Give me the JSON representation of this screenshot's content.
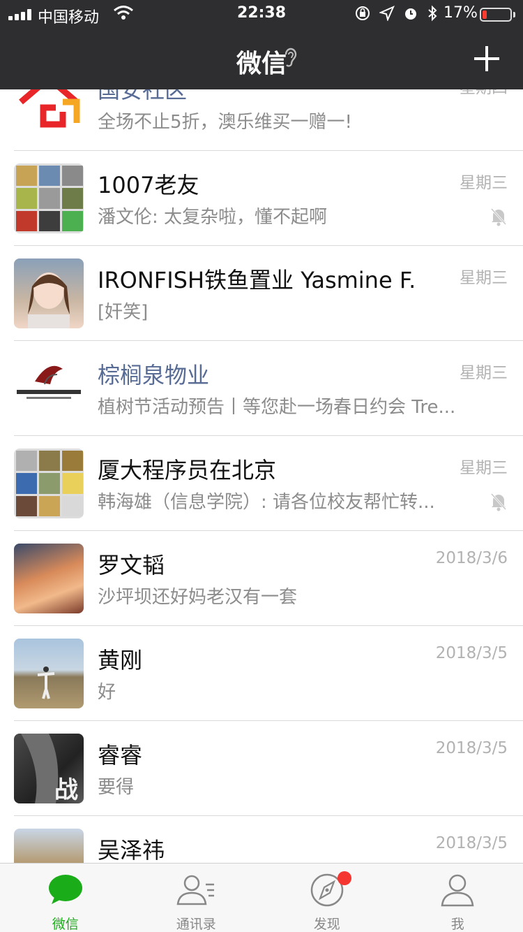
{
  "status_bar": {
    "carrier": "中国移动",
    "time": "22:38",
    "battery_percent": "17%",
    "battery_level": 0.17,
    "battery_color": "#ff3b30"
  },
  "nav": {
    "title": "微信",
    "title_icon": "ear-icon",
    "add_icon": "plus-icon"
  },
  "chats": [
    {
      "name": "国安社区",
      "preview": "全场不止5折，澳乐维买一赠一!",
      "time": "星期四",
      "official": true,
      "muted": false
    },
    {
      "name": "1007老友",
      "preview": "潘文伦: 太复杂啦，懂不起啊",
      "time": "星期三",
      "official": false,
      "muted": true
    },
    {
      "name": "IRONFISH铁鱼置业 Yasmine F.",
      "preview": "[奸笑]",
      "time": "星期三",
      "official": false,
      "muted": false
    },
    {
      "name": "棕榈泉物业",
      "preview": "植树节活动预告丨等您赴一场春日约会 Tre...",
      "time": "星期三",
      "official": true,
      "muted": false
    },
    {
      "name": "厦大程序员在北京",
      "preview": "韩海雄（信息学院）: 请各位校友帮忙转...",
      "time": "星期三",
      "official": false,
      "muted": true
    },
    {
      "name": "罗文韬",
      "preview": "沙坪坝还好妈老汉有一套",
      "time": "2018/3/6",
      "official": false,
      "muted": false
    },
    {
      "name": "黄刚",
      "preview": "好",
      "time": "2018/3/5",
      "official": false,
      "muted": false
    },
    {
      "name": "睿睿",
      "preview": "要得",
      "time": "2018/3/5",
      "official": false,
      "muted": false
    },
    {
      "name": "吴泽祎",
      "preview": "",
      "time": "2018/3/5",
      "official": false,
      "muted": false
    }
  ],
  "tabs": [
    {
      "label": "微信",
      "icon": "chat-bubble-icon",
      "active": true
    },
    {
      "label": "通讯录",
      "icon": "contacts-icon",
      "active": false
    },
    {
      "label": "发现",
      "icon": "compass-icon",
      "active": false,
      "badge_dot": true
    },
    {
      "label": "我",
      "icon": "person-icon",
      "active": false
    }
  ],
  "colors": {
    "header_bg": "#2e2e30",
    "accent_green": "#1aad19",
    "official_name": "#576b95",
    "badge_red": "#f43530"
  }
}
